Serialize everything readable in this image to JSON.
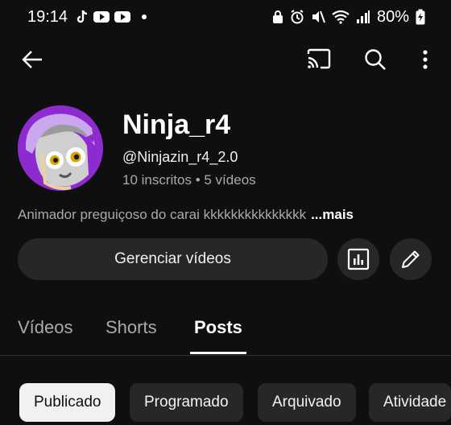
{
  "status_bar": {
    "time": "19:14",
    "battery": "80%"
  },
  "channel": {
    "name": "Ninja_r4",
    "handle": "@Ninjazin_r4_2.0",
    "stats": "10 inscritos • 5 vídeos",
    "bio": "Animador preguiçoso do carai kkkkkkkkkkkkkkk",
    "bio_more": "...mais"
  },
  "actions": {
    "manage_videos": "Gerenciar vídeos"
  },
  "tabs": [
    {
      "label": "Vídeos",
      "active": false
    },
    {
      "label": "Shorts",
      "active": false
    },
    {
      "label": "Posts",
      "active": true
    }
  ],
  "chips": [
    {
      "label": "Publicado",
      "selected": true
    },
    {
      "label": "Programado",
      "selected": false
    },
    {
      "label": "Arquivado",
      "selected": false
    },
    {
      "label": "Atividade",
      "selected": false
    }
  ],
  "colors": {
    "background": "#0f0f0f",
    "surface": "#272727",
    "avatar_bg": "#8d2bd0"
  },
  "icons": {
    "back": "arrow-left-icon",
    "cast": "cast-icon",
    "search": "search-icon",
    "more": "more-vert-icon",
    "analytics": "analytics-icon",
    "edit": "pencil-icon"
  }
}
